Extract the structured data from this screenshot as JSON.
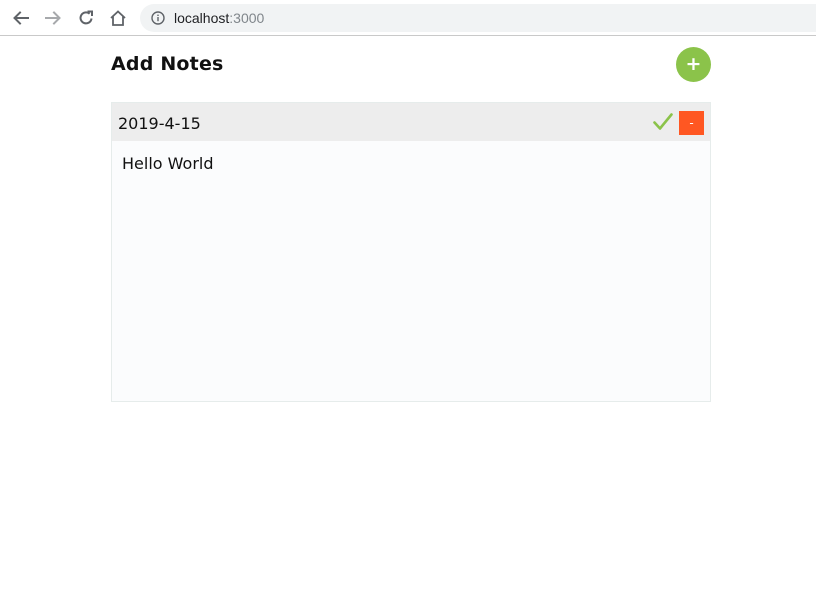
{
  "browser": {
    "url_host": "localhost",
    "url_port": ":3000",
    "back_icon": "back-arrow-icon",
    "forward_icon": "forward-arrow-icon",
    "reload_icon": "reload-icon",
    "home_icon": "home-icon",
    "info_icon": "info-icon"
  },
  "app": {
    "title": "Add Notes",
    "add_button_label": "+",
    "add_button_color": "#8bc34a"
  },
  "notes": [
    {
      "date": "2019-4-15",
      "body": "Hello World",
      "save_icon": "checkmark-icon",
      "save_icon_color": "#8bc34a",
      "delete_label": "-",
      "delete_color": "#ff5722"
    }
  ]
}
